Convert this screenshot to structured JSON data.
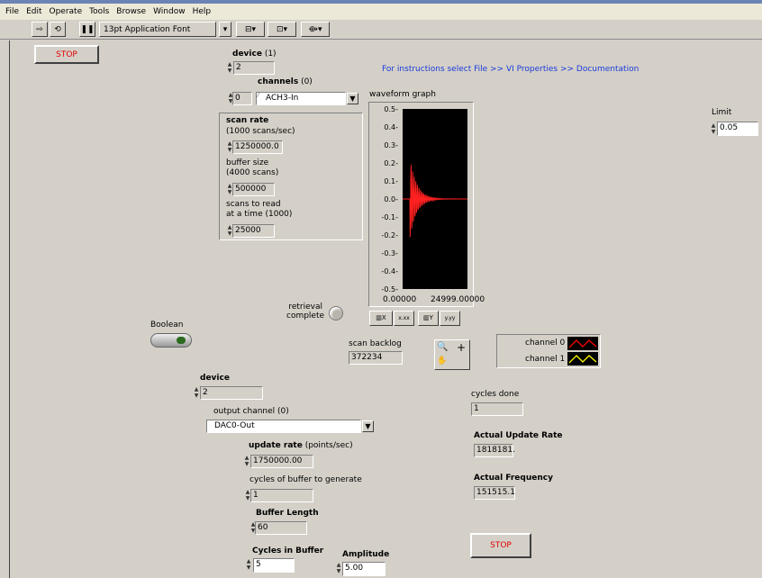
{
  "menu": [
    "File",
    "Edit",
    "Operate",
    "Tools",
    "Browse",
    "Window",
    "Help"
  ],
  "toolbar": {
    "font": "13pt Application Font"
  },
  "stop_top": "STOP",
  "stop_bottom": "STOP",
  "instructions": "For instructions select File >> VI Properties >> Documentation",
  "device1": {
    "label": "device",
    "default": "(1)",
    "value": "2"
  },
  "channels": {
    "label": "channels",
    "default": "(0)",
    "index": "0",
    "value": "ACH3-In"
  },
  "scan_cluster": {
    "scan_rate_label": "scan rate",
    "scan_rate_sub": "(1000 scans/sec)",
    "scan_rate_value": "1250000.0",
    "buffer_size_label": "buffer size",
    "buffer_size_sub": "(4000 scans)",
    "buffer_size_value": "500000",
    "scans_to_read_label": "scans to read",
    "scans_to_read_sub": "at a time (1000)",
    "scans_to_read_value": "25000"
  },
  "graph": {
    "title": "waveform graph",
    "yticks": [
      "0.5-",
      "0.4-",
      "0.3-",
      "0.2-",
      "0.1-",
      "0.0-",
      "-0.1-",
      "-0.2-",
      "-0.3-",
      "-0.4-",
      "-0.5-"
    ],
    "xmin": "0.00000",
    "xmax": "24999.00000"
  },
  "limit": {
    "label": "Limit",
    "value": "0.05"
  },
  "retrieval": {
    "line1": "retrieval",
    "line2": "complete"
  },
  "boolean": {
    "label": "Boolean"
  },
  "scan_backlog": {
    "label": "scan backlog",
    "value": "372234"
  },
  "legend": {
    "ch0": "channel 0",
    "ch1": "channel 1",
    "ch0_color": "#ff0000",
    "ch1_color": "#ffff00"
  },
  "device2": {
    "label": "device",
    "value": "2"
  },
  "output_channel": {
    "label": "output channel (0)",
    "value": "DAC0-Out"
  },
  "update_rate": {
    "label": "update rate",
    "sub": "(points/sec)",
    "value": "1750000.00"
  },
  "cycles_gen": {
    "label": "cycles of buffer to generate",
    "value": "1"
  },
  "buffer_length": {
    "label": "Buffer Length",
    "value": "60"
  },
  "cycles_in_buffer": {
    "label": "Cycles in Buffer",
    "value": "5"
  },
  "amplitude": {
    "label": "Amplitude",
    "value": "5.00"
  },
  "cycles_done": {
    "label": "cycles done",
    "value": "1"
  },
  "actual_update_rate": {
    "label": "Actual Update Rate",
    "value": "1818181."
  },
  "actual_frequency": {
    "label": "Actual Frequency",
    "value": "151515.1"
  }
}
